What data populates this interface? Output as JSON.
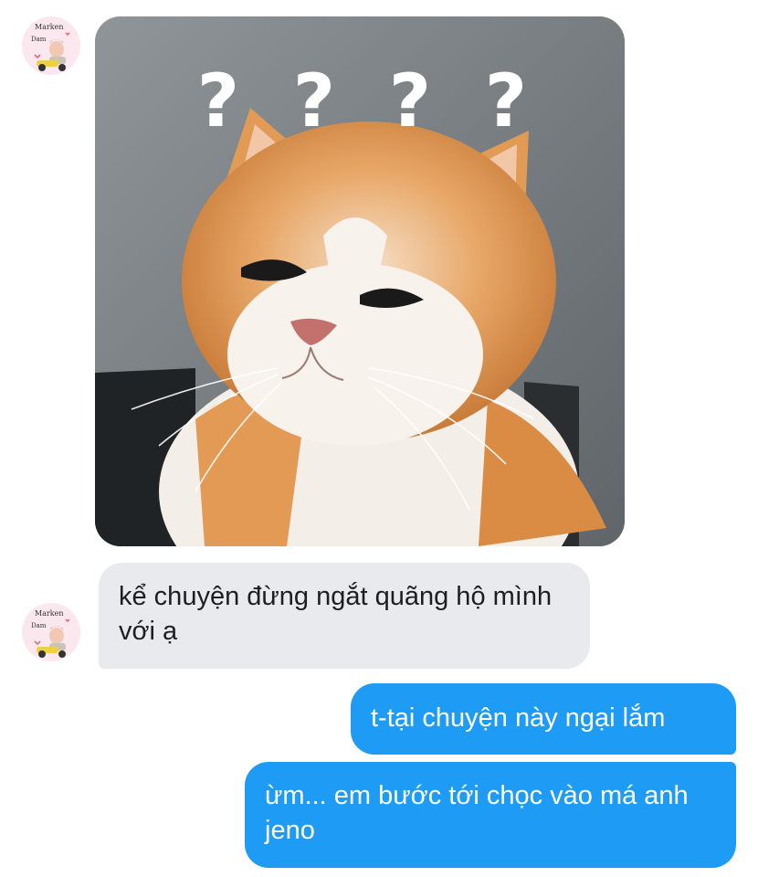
{
  "conversation": {
    "messages": [
      {
        "sender": "contact",
        "kind": "image",
        "image_caption": "????"
      },
      {
        "sender": "contact",
        "kind": "text",
        "text": "kể chuyện đừng ngắt quãng hộ mình với ạ"
      },
      {
        "sender": "me",
        "kind": "text",
        "text": "t-tại chuyện này ngại lắm"
      },
      {
        "sender": "me",
        "kind": "text",
        "text": "ừm... em bước tới chọc vào má anh jeno"
      }
    ]
  },
  "contact": {
    "avatar_text_top": "Marken",
    "avatar_text_bottom": "Dam"
  },
  "colors": {
    "incoming_bubble": "#e9eaee",
    "outgoing_bubble": "#1e9bf5",
    "background": "#ffffff"
  }
}
